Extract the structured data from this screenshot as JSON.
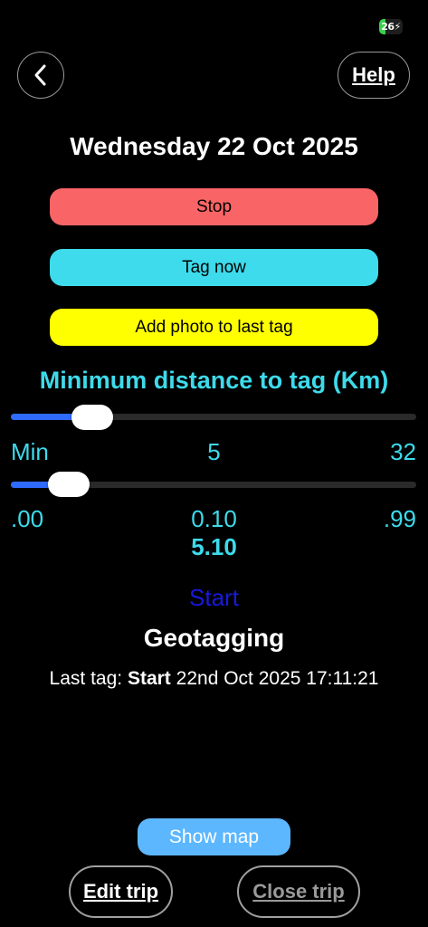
{
  "status_bar": {
    "battery_text": "26",
    "battery_level_percent": 26,
    "battery_color": "#3ccf4e"
  },
  "nav": {
    "back_icon": "chevron-left-icon",
    "help_label": "Help"
  },
  "date_title": "Wednesday 22 Oct 2025",
  "actions": {
    "stop_label": "Stop",
    "tag_now_label": "Tag now",
    "add_photo_label": "Add photo to last tag"
  },
  "min_distance": {
    "title": "Minimum distance to tag (Km)",
    "coarse_slider": {
      "min_label": "Min",
      "value_label": "5",
      "max_label": "32",
      "value": 5,
      "min": 0,
      "max": 32
    },
    "fine_slider": {
      "min_label": ".00",
      "value_label": "0.10",
      "max_label": ".99",
      "value": 0.1,
      "min": 0,
      "max": 0.99
    },
    "total_value": "5.10"
  },
  "start_link_label": "Start",
  "geotagging_title": "Geotagging",
  "last_tag": {
    "prefix": "Last tag:",
    "name": "Start",
    "timestamp": "22nd Oct 2025 17:11:21"
  },
  "bottom": {
    "show_map_label": "Show map",
    "edit_trip_label": "Edit trip",
    "close_trip_label": "Close trip"
  },
  "colors": {
    "stop": "#f96566",
    "tag_now": "#3ddbeb",
    "add_photo": "#ffff00",
    "accent_cyan": "#3ddbeb",
    "slider_fill": "#2f6bff",
    "start_link": "#1818e0",
    "show_map": "#5cb7ff"
  }
}
